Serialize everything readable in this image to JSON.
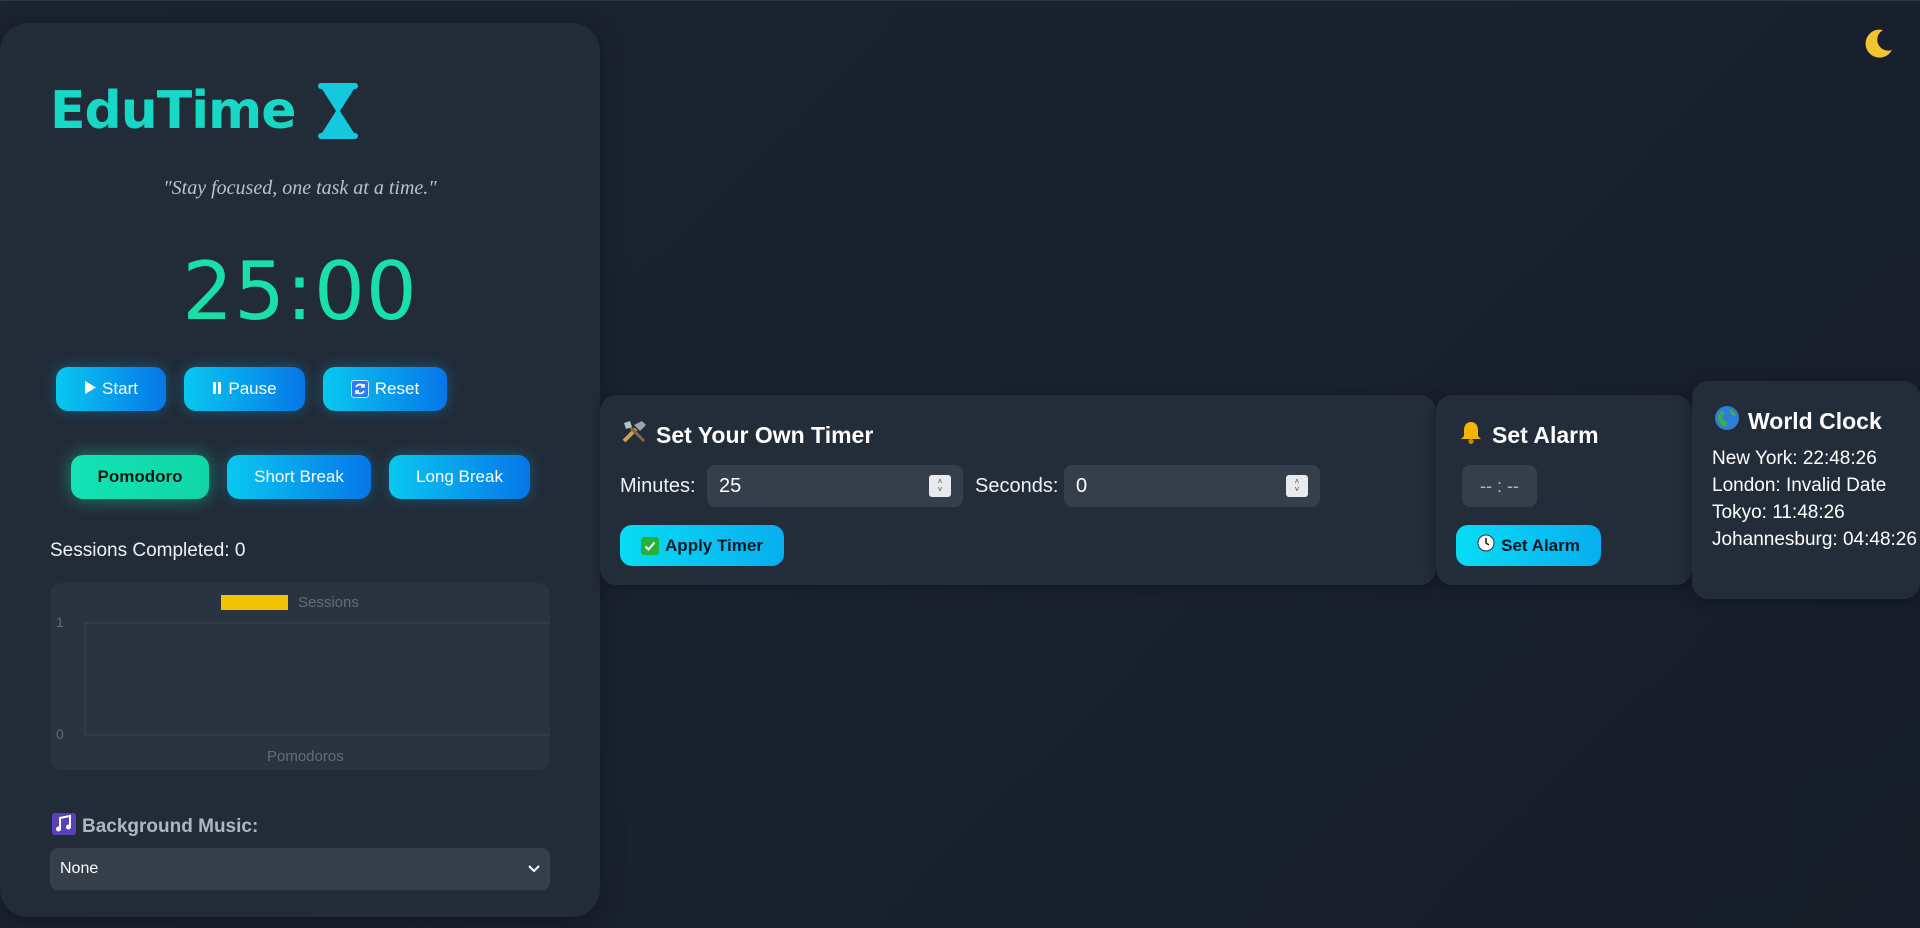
{
  "theme_toggle": {
    "icon": "moon-icon"
  },
  "app": {
    "title": "EduTime",
    "quote": "\"Stay focused, one task at a time.\"",
    "timer": "25:00"
  },
  "controls": {
    "start": "Start",
    "pause": "Pause",
    "reset": "Reset"
  },
  "modes": {
    "pomodoro": "Pomodoro",
    "short_break": "Short Break",
    "long_break": "Long Break",
    "active": "Pomodoro"
  },
  "sessions": {
    "label": "Sessions Completed: 0",
    "count": 0
  },
  "chart_data": {
    "type": "bar",
    "categories": [],
    "series": [
      {
        "name": "Sessions",
        "values": []
      }
    ],
    "xlabel": "Pomodoros",
    "ylabel": "",
    "ylim": [
      0,
      1
    ],
    "yticks": [
      "1",
      "0"
    ],
    "legend": "top-center",
    "legend_color": "#f2c300"
  },
  "music": {
    "label": "Background Music:",
    "selected": "None"
  },
  "custom_timer": {
    "title": "Set Your Own Timer",
    "minutes_label": "Minutes:",
    "minutes_value": "25",
    "seconds_label": "Seconds:",
    "seconds_value": "0",
    "apply": "Apply Timer"
  },
  "alarm": {
    "title": "Set Alarm",
    "time_placeholder": "-- : --",
    "button": "Set Alarm"
  },
  "world_clock": {
    "title": "World Clock",
    "entries": [
      "New York: 22:48:26",
      "London: Invalid Date",
      "Tokyo: 11:48:26",
      "Johannesburg: 04:48:26"
    ]
  },
  "colors": {
    "accent": "#16d8c4",
    "timer": "#19e0a8",
    "button": "#08c8f0",
    "legend": "#f2c300"
  }
}
